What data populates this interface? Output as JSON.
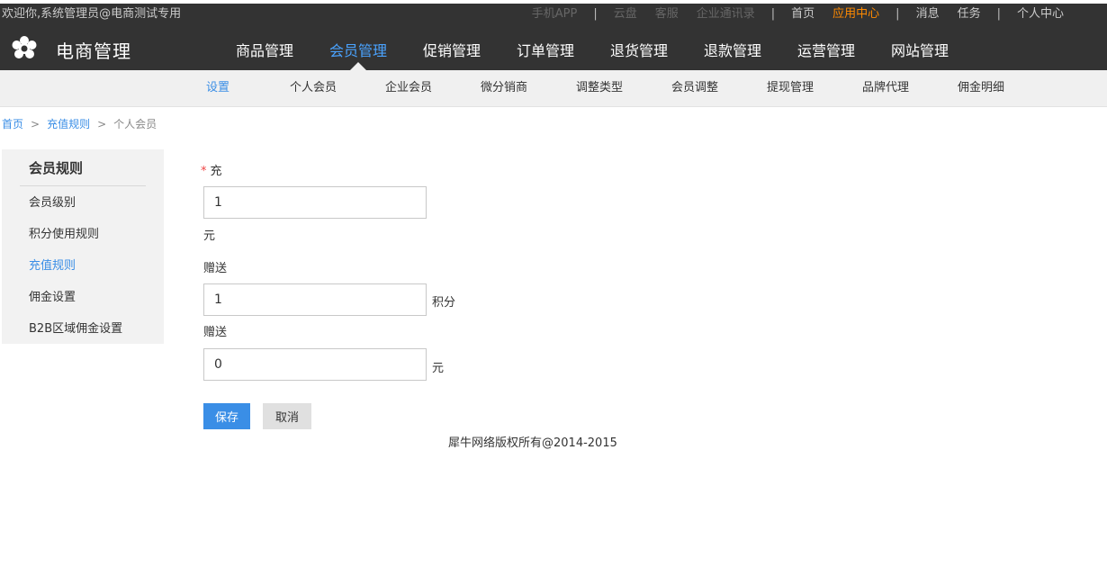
{
  "topbar": {
    "welcome": "欢迎你,系统管理员@电商测试专用",
    "links": [
      {
        "label": "手机APP",
        "style": "dim"
      },
      {
        "label": "|",
        "style": "sep"
      },
      {
        "label": "云盘",
        "style": "dim"
      },
      {
        "label": "客服",
        "style": "dim"
      },
      {
        "label": "企业通讯录",
        "style": "dim"
      },
      {
        "label": "|",
        "style": "sep"
      },
      {
        "label": "首页",
        "style": "bright"
      },
      {
        "label": "应用中心",
        "style": "hot"
      },
      {
        "label": "|",
        "style": "sep"
      },
      {
        "label": "消息",
        "style": "bright"
      },
      {
        "label": "任务",
        "style": "bright"
      },
      {
        "label": "|",
        "style": "sep"
      },
      {
        "label": "个人中心",
        "style": "bright"
      }
    ]
  },
  "header": {
    "logo_icon": "flower-gear-icon",
    "brand": "电商管理",
    "nav": [
      {
        "label": "商品管理",
        "active": false
      },
      {
        "label": "会员管理",
        "active": true
      },
      {
        "label": "促销管理",
        "active": false
      },
      {
        "label": "订单管理",
        "active": false
      },
      {
        "label": "退货管理",
        "active": false
      },
      {
        "label": "退款管理",
        "active": false
      },
      {
        "label": "运营管理",
        "active": false
      },
      {
        "label": "网站管理",
        "active": false
      }
    ]
  },
  "subnav": [
    {
      "label": "设置",
      "active": true
    },
    {
      "label": "个人会员",
      "active": false
    },
    {
      "label": "企业会员",
      "active": false
    },
    {
      "label": "微分销商",
      "active": false
    },
    {
      "label": "调整类型",
      "active": false
    },
    {
      "label": "会员调整",
      "active": false
    },
    {
      "label": "提现管理",
      "active": false
    },
    {
      "label": "品牌代理",
      "active": false
    },
    {
      "label": "佣金明细",
      "active": false
    }
  ],
  "breadcrumb": {
    "home": "首页",
    "sep": ">",
    "section": "充值规则",
    "current": "个人会员"
  },
  "sidebar": {
    "title": "会员规则",
    "items": [
      {
        "label": "会员级别",
        "active": false
      },
      {
        "label": "积分使用规则",
        "active": false
      },
      {
        "label": "充值规则",
        "active": true
      },
      {
        "label": "佣金设置",
        "active": false
      },
      {
        "label": "B2B区域佣金设置",
        "active": false
      }
    ]
  },
  "form": {
    "required_mark": "*",
    "recharge_label": "充",
    "recharge_value": "1",
    "recharge_unit": "元",
    "gift_points_label": "赠送",
    "gift_points_value": "1",
    "gift_points_unit": "积分",
    "gift_cash_label": "赠送",
    "gift_cash_value": "0",
    "gift_cash_unit": "元",
    "save_label": "保存",
    "cancel_label": "取消"
  },
  "footer": "犀牛网络版权所有@2014-2015",
  "colors": {
    "accent": "#3a8ee6",
    "hot": "#ff8a00",
    "dark_bar": "#333333",
    "subnav_bg": "#f0f0f0"
  }
}
